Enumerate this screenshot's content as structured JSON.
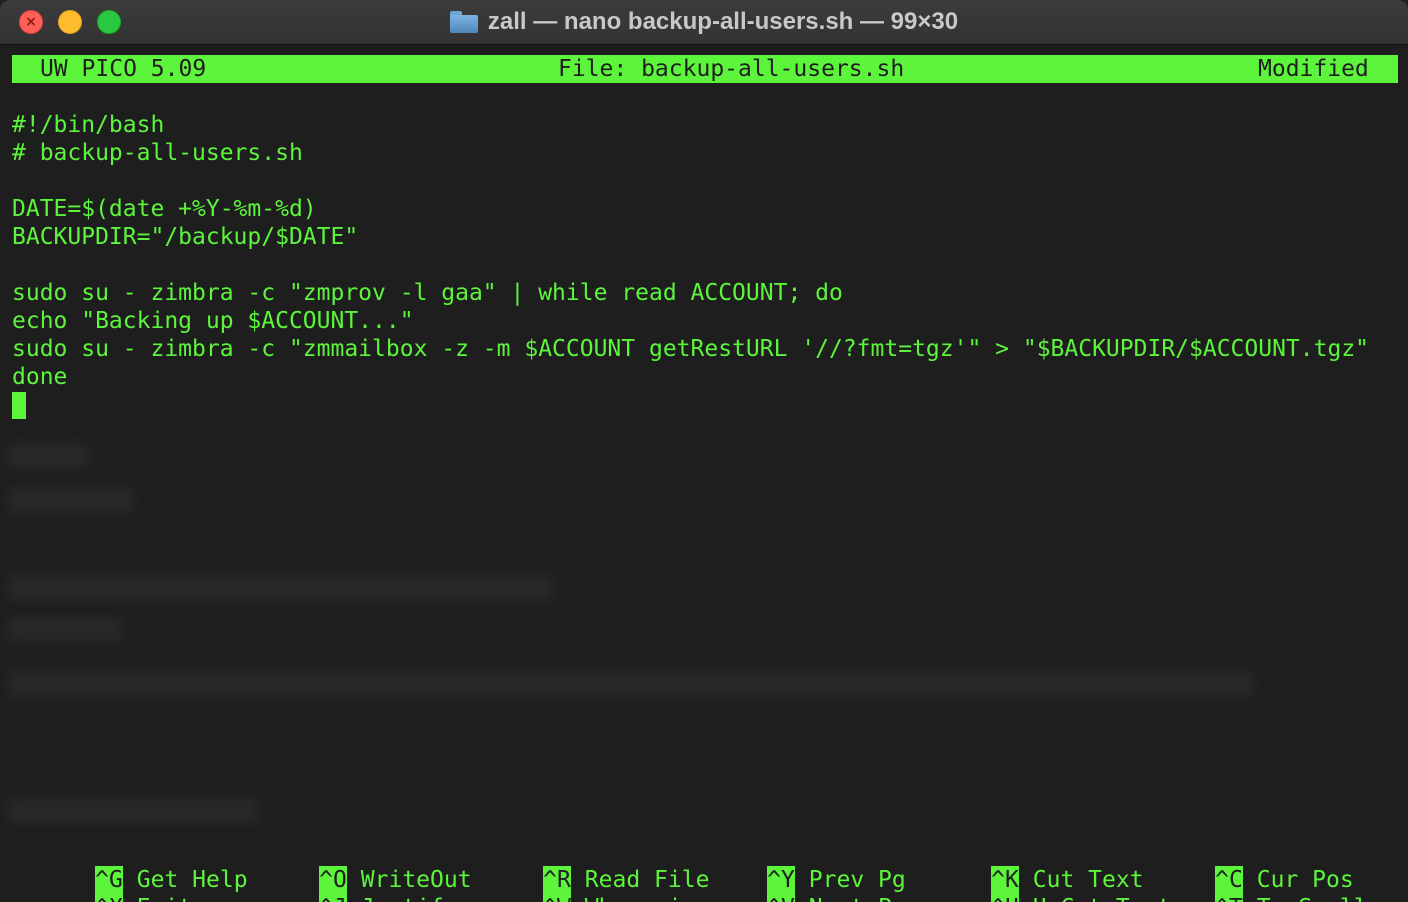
{
  "window": {
    "title": "zall — nano backup-all-users.sh — 99×30"
  },
  "editor": {
    "app_name": "UW PICO 5.09",
    "file_label": "File: backup-all-users.sh",
    "status": "Modified",
    "lines": [
      "#!/bin/bash",
      "# backup-all-users.sh",
      "",
      "DATE=$(date +%Y-%m-%d)",
      "BACKUPDIR=\"/backup/$DATE\"",
      "",
      "sudo su - zimbra -c \"zmprov -l gaa\" | while read ACCOUNT; do",
      "echo \"Backing up $ACCOUNT...\"",
      "sudo su - zimbra -c \"zmmailbox -z -m $ACCOUNT getRestURL '//?fmt=tgz'\" > \"$BACKUPDIR/$ACCOUNT.tgz\"",
      "done"
    ]
  },
  "shortcuts": [
    {
      "key": "^G",
      "label": "Get Help"
    },
    {
      "key": "^X",
      "label": "Exit"
    },
    {
      "key": "^O",
      "label": "WriteOut"
    },
    {
      "key": "^J",
      "label": "Justify"
    },
    {
      "key": "^R",
      "label": "Read File"
    },
    {
      "key": "^W",
      "label": "Where is"
    },
    {
      "key": "^Y",
      "label": "Prev Pg"
    },
    {
      "key": "^V",
      "label": "Next Pg"
    },
    {
      "key": "^K",
      "label": "Cut Text"
    },
    {
      "key": "^U",
      "label": "UnCut Text"
    },
    {
      "key": "^C",
      "label": "Cur Pos"
    },
    {
      "key": "^T",
      "label": "To Spell"
    }
  ],
  "colors": {
    "terminal_bg": "#1e1e1e",
    "terminal_fg": "#5cf53c",
    "close": "#fe5f57",
    "minimize": "#febc2e",
    "maximize": "#28c840"
  },
  "icons": [
    "close-icon",
    "folder-icon"
  ]
}
